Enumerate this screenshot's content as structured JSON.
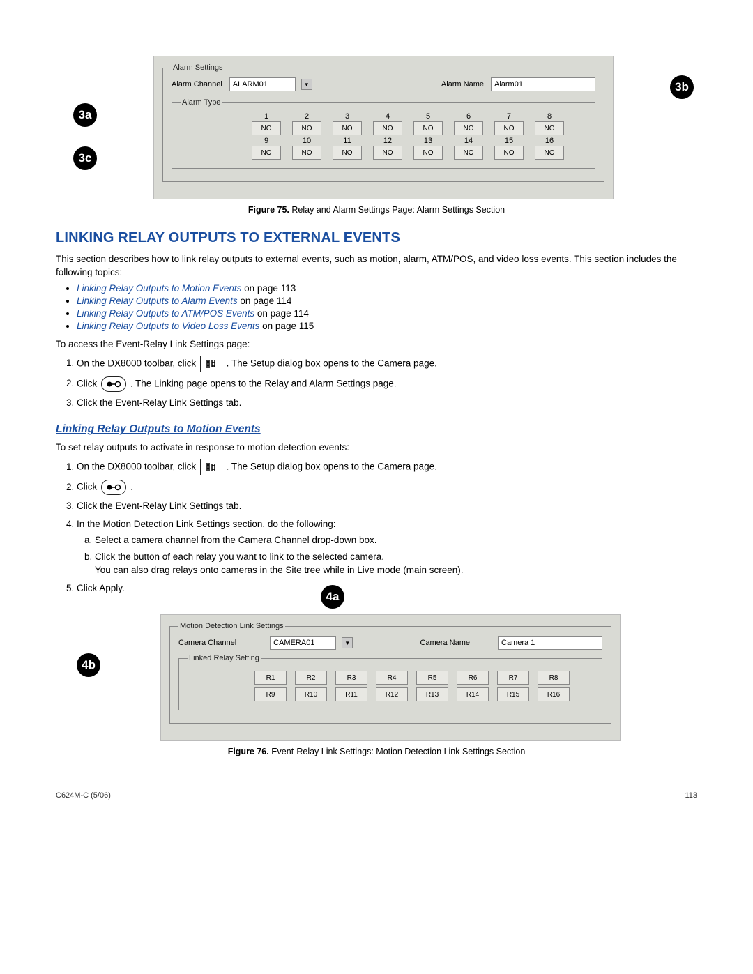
{
  "figure75": {
    "caption_label": "Figure 75.",
    "caption_text": "Relay and Alarm Settings Page: Alarm Settings Section",
    "alarm_settings_legend": "Alarm Settings",
    "alarm_channel_label": "Alarm Channel",
    "alarm_channel_value": "ALARM01",
    "alarm_name_label": "Alarm Name",
    "alarm_name_value": "Alarm01",
    "alarm_type_legend": "Alarm Type",
    "columns": [
      "1",
      "2",
      "3",
      "4",
      "5",
      "6",
      "7",
      "8",
      "9",
      "10",
      "11",
      "12",
      "13",
      "14",
      "15",
      "16"
    ],
    "btn_value": "NO",
    "callouts": {
      "a": "3a",
      "b": "3b",
      "c": "3c"
    }
  },
  "section_heading": "LINKING RELAY OUTPUTS TO EXTERNAL EVENTS",
  "intro": "This section describes how to link relay outputs to external events, such as motion, alarm, ATM/POS, and video loss events. This section includes the following topics:",
  "bullets": [
    {
      "link": "Linking Relay Outputs to Motion Events",
      "suffix": " on page 113"
    },
    {
      "link": "Linking Relay Outputs to Alarm Events",
      "suffix": " on page 114"
    },
    {
      "link": "Linking Relay Outputs to ATM/POS Events",
      "suffix": " on page 114"
    },
    {
      "link": "Linking Relay Outputs to Video Loss Events",
      "suffix": " on page 115"
    }
  ],
  "access_intro": "To access the Event-Relay Link Settings page:",
  "steps_access": {
    "s1a": "On the DX8000 toolbar, click ",
    "s1b": " . The Setup dialog box opens to the Camera page.",
    "s2a": "Click ",
    "s2b": " . The Linking page opens to the Relay and Alarm Settings page.",
    "s3": "Click the Event-Relay Link Settings tab."
  },
  "sub_heading": "Linking Relay Outputs to Motion Events",
  "motion_intro": "To set relay outputs to activate in response to motion detection events:",
  "steps_motion": {
    "s1a": "On the DX8000 toolbar, click ",
    "s1b": " . The Setup dialog box opens to the Camera page.",
    "s2": "Click ",
    "s2b": " .",
    "s3": "Click the Event-Relay Link Settings tab.",
    "s4": "In the Motion Detection Link Settings section, do the following:",
    "s4a": "Select a camera channel from the Camera Channel drop-down box.",
    "s4b": "Click the button of each relay you want to link to the selected camera.",
    "s4b2": "You can also drag relays onto cameras in the Site tree while in Live mode (main screen).",
    "s5": "Click Apply."
  },
  "figure76": {
    "caption_label": "Figure 76.",
    "caption_text": "Event-Relay Link Settings: Motion Detection Link Settings Section",
    "motion_legend": "Motion Detection Link Settings",
    "camera_channel_label": "Camera Channel",
    "camera_channel_value": "CAMERA01",
    "camera_name_label": "Camera Name",
    "camera_name_value": "Camera 1",
    "linked_relay_legend": "Linked Relay Setting",
    "relays": [
      "R1",
      "R2",
      "R3",
      "R4",
      "R5",
      "R6",
      "R7",
      "R8",
      "R9",
      "R10",
      "R11",
      "R12",
      "R13",
      "R14",
      "R15",
      "R16"
    ],
    "callouts": {
      "a": "4a",
      "b": "4b"
    }
  },
  "footer": {
    "left": "C624M-C (5/06)",
    "right": "113"
  },
  "chart_data": {
    "type": "table",
    "figure75_alarm_types": {
      "channels": [
        1,
        2,
        3,
        4,
        5,
        6,
        7,
        8,
        9,
        10,
        11,
        12,
        13,
        14,
        15,
        16
      ],
      "values": [
        "NO",
        "NO",
        "NO",
        "NO",
        "NO",
        "NO",
        "NO",
        "NO",
        "NO",
        "NO",
        "NO",
        "NO",
        "NO",
        "NO",
        "NO",
        "NO"
      ]
    },
    "figure76_relays": [
      "R1",
      "R2",
      "R3",
      "R4",
      "R5",
      "R6",
      "R7",
      "R8",
      "R9",
      "R10",
      "R11",
      "R12",
      "R13",
      "R14",
      "R15",
      "R16"
    ]
  }
}
